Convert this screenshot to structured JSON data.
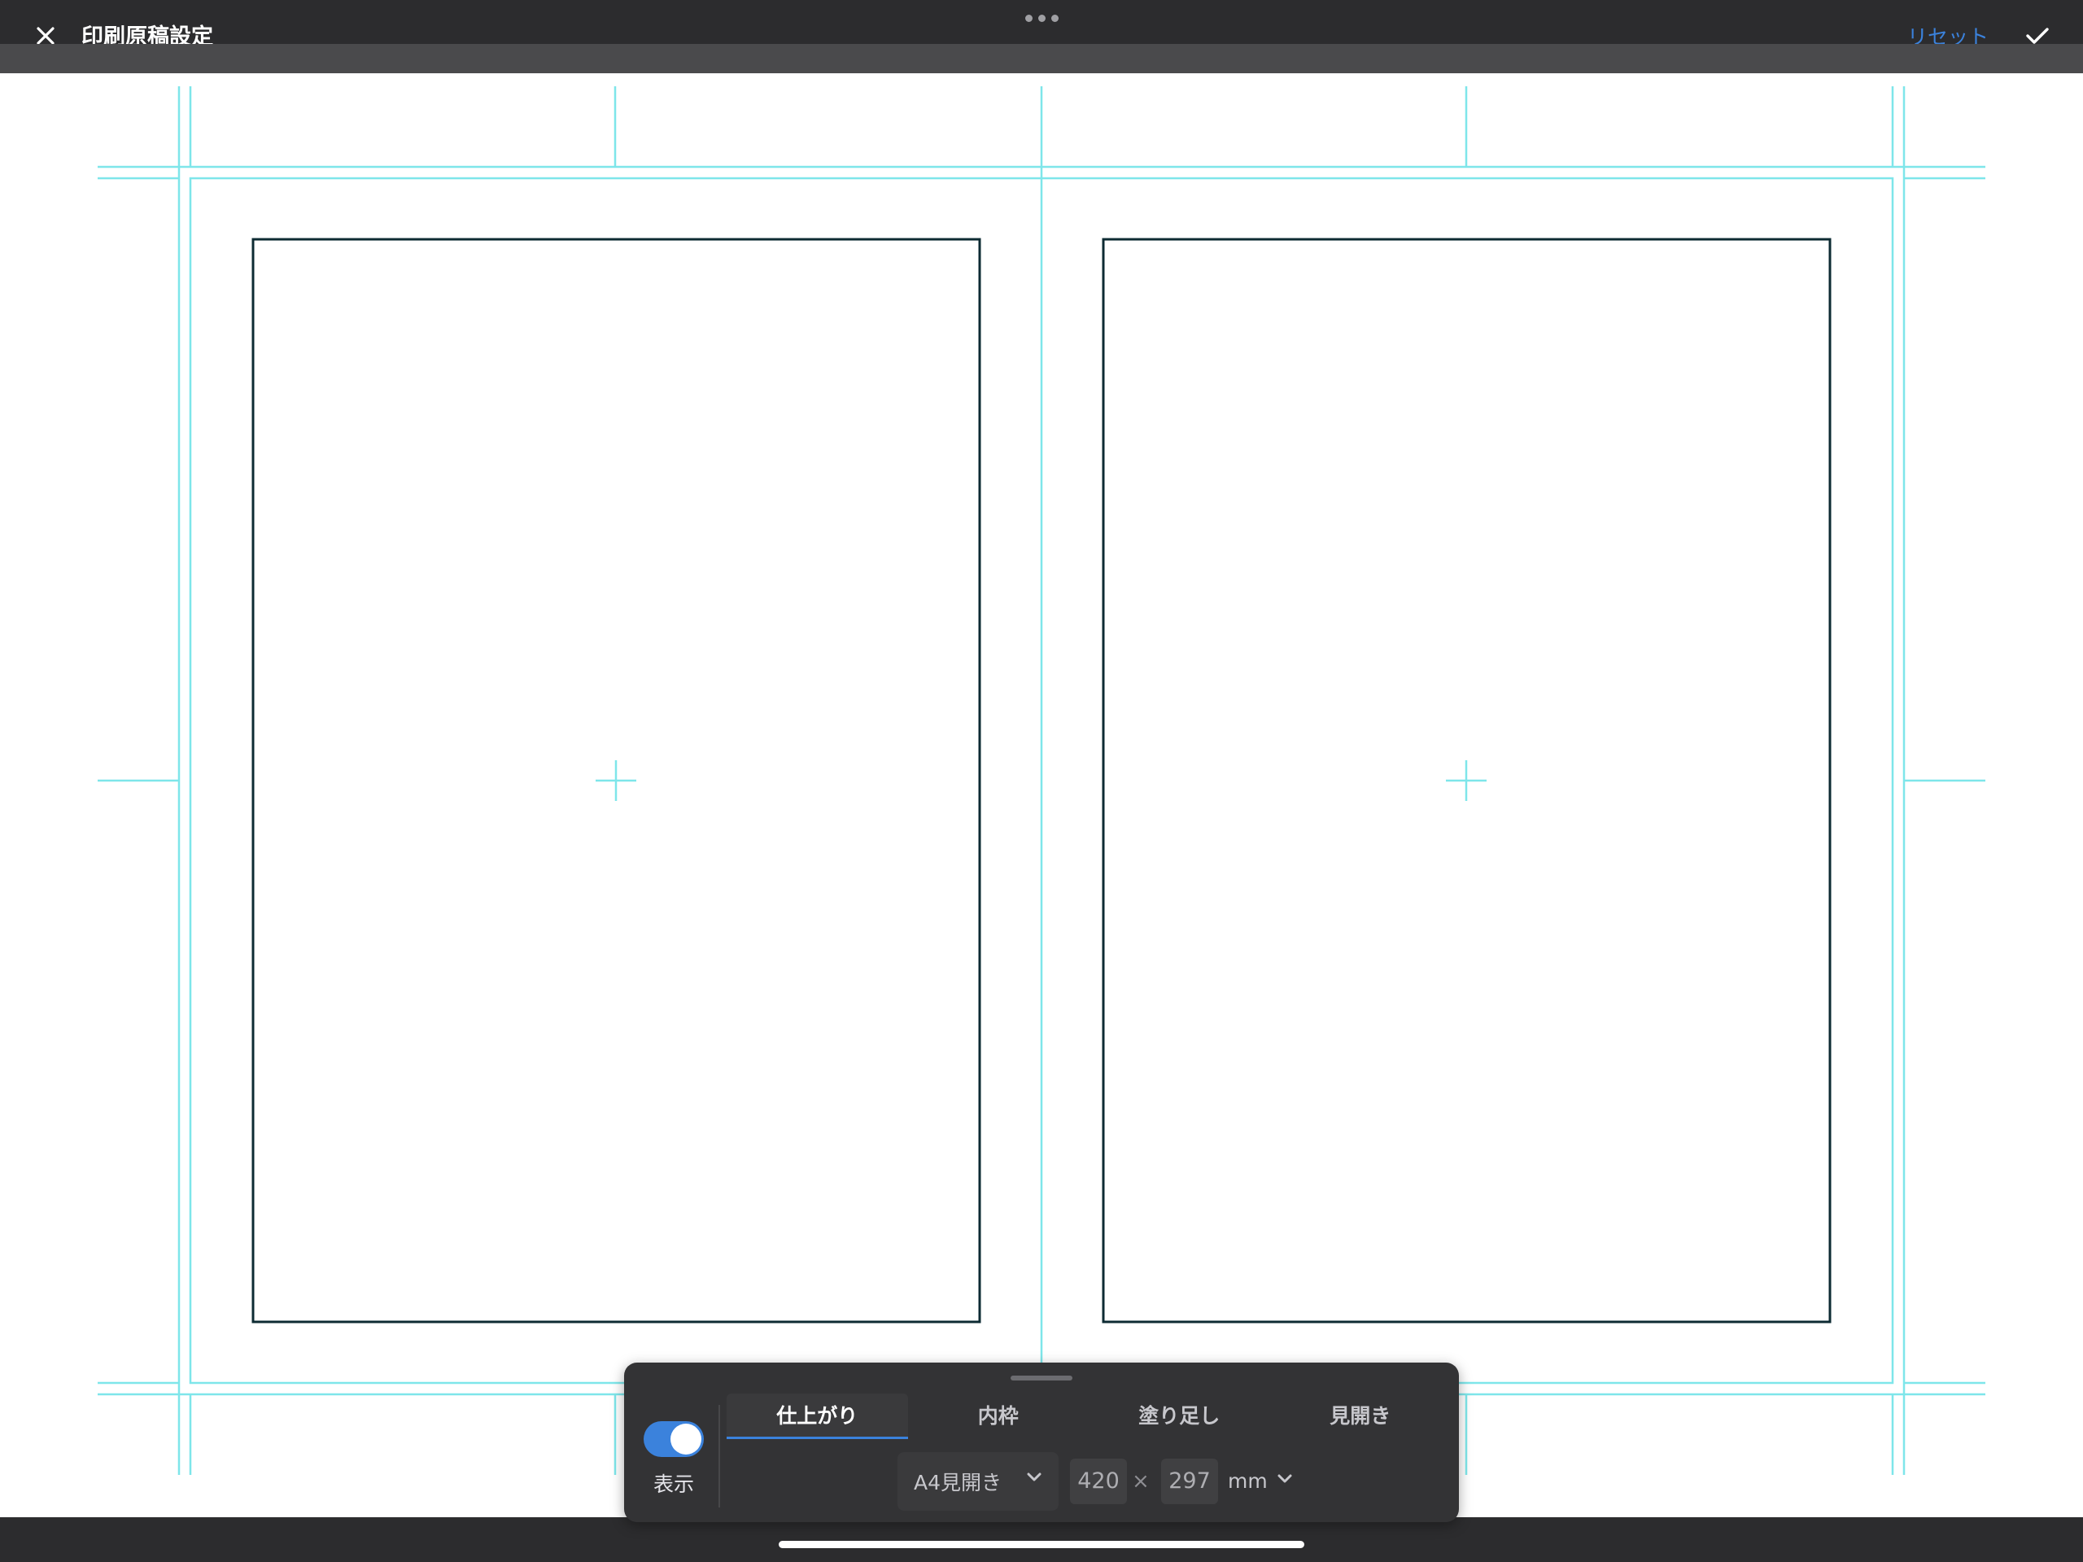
{
  "header": {
    "title": "印刷原稿設定",
    "reset_label": "リセット",
    "close_icon": "close-icon",
    "confirm_icon": "checkmark-icon",
    "more_icon": "more-dots-icon"
  },
  "panel": {
    "toggle": {
      "label": "表示",
      "on": true
    },
    "tabs": [
      {
        "label": "仕上がり",
        "active": true
      },
      {
        "label": "内枠",
        "active": false
      },
      {
        "label": "塗り足し",
        "active": false
      },
      {
        "label": "見開き",
        "active": false
      }
    ],
    "preset": {
      "value": "A4見開き"
    },
    "width": "420",
    "times": "×",
    "height": "297",
    "unit": "mm"
  },
  "colors": {
    "guide_cyan": "#7ee6ea",
    "frame_dark": "#0d2b33",
    "accent_blue": "#3b82dc",
    "header_bg": "#2c2c2e",
    "panel_bg": "#333335"
  }
}
